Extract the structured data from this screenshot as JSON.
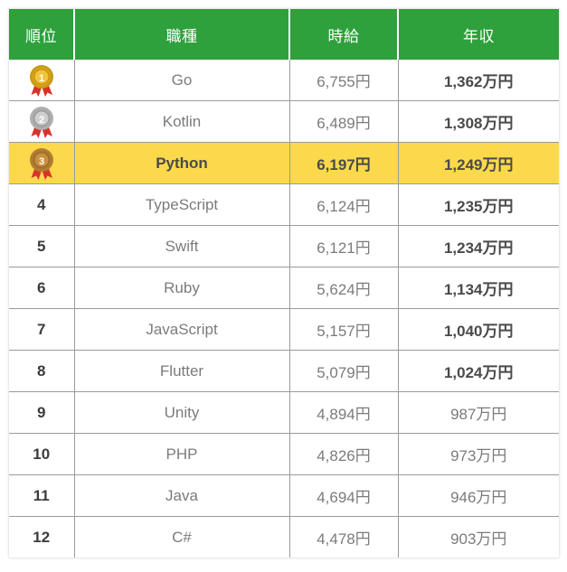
{
  "table": {
    "columns": [
      {
        "key": "rank",
        "label": "順位",
        "icon": ""
      },
      {
        "key": "job",
        "label": "職種",
        "icon": ""
      },
      {
        "key": "hourly",
        "label": "時給",
        "icon": ""
      },
      {
        "key": "annual",
        "label": "年収",
        "icon": ""
      }
    ],
    "colors": {
      "header_background": "#2ea03c",
      "header_text": "#ffffff",
      "highlight_background": "#fcd94b",
      "body_text": "#7b7b7b",
      "rank_text": "#3c3c3c",
      "annual_text": "#4a4a4a",
      "border": "#9a9a9a",
      "gold_medal": "#e8b323",
      "silver_medal": "#b8b8b8",
      "bronze_medal": "#c08b3e",
      "ribbon": "#d8332a"
    },
    "rows": [
      {
        "rank": "1",
        "medal": "gold-medal-icon",
        "job": "Go",
        "hourly": "6,755円",
        "annual": "1,362万円",
        "highlight": false,
        "annual_bold": true
      },
      {
        "rank": "2",
        "medal": "silver-medal-icon",
        "job": "Kotlin",
        "hourly": "6,489円",
        "annual": "1,308万円",
        "highlight": false,
        "annual_bold": true
      },
      {
        "rank": "3",
        "medal": "bronze-medal-icon",
        "job": "Python",
        "hourly": "6,197円",
        "annual": "1,249万円",
        "highlight": true,
        "annual_bold": true
      },
      {
        "rank": "4",
        "medal": "",
        "job": "TypeScript",
        "hourly": "6,124円",
        "annual": "1,235万円",
        "highlight": false,
        "annual_bold": true
      },
      {
        "rank": "5",
        "medal": "",
        "job": "Swift",
        "hourly": "6,121円",
        "annual": "1,234万円",
        "highlight": false,
        "annual_bold": true
      },
      {
        "rank": "6",
        "medal": "",
        "job": "Ruby",
        "hourly": "5,624円",
        "annual": "1,134万円",
        "highlight": false,
        "annual_bold": true
      },
      {
        "rank": "7",
        "medal": "",
        "job": "JavaScript",
        "hourly": "5,157円",
        "annual": "1,040万円",
        "highlight": false,
        "annual_bold": true
      },
      {
        "rank": "8",
        "medal": "",
        "job": "Flutter",
        "hourly": "5,079円",
        "annual": "1,024万円",
        "highlight": false,
        "annual_bold": true
      },
      {
        "rank": "9",
        "medal": "",
        "job": "Unity",
        "hourly": "4,894円",
        "annual": "987万円",
        "highlight": false,
        "annual_bold": false
      },
      {
        "rank": "10",
        "medal": "",
        "job": "PHP",
        "hourly": "4,826円",
        "annual": "973万円",
        "highlight": false,
        "annual_bold": false
      },
      {
        "rank": "11",
        "medal": "",
        "job": "Java",
        "hourly": "4,694円",
        "annual": "946万円",
        "highlight": false,
        "annual_bold": false
      },
      {
        "rank": "12",
        "medal": "",
        "job": "C#",
        "hourly": "4,478円",
        "annual": "903万円",
        "highlight": false,
        "annual_bold": false
      }
    ]
  }
}
